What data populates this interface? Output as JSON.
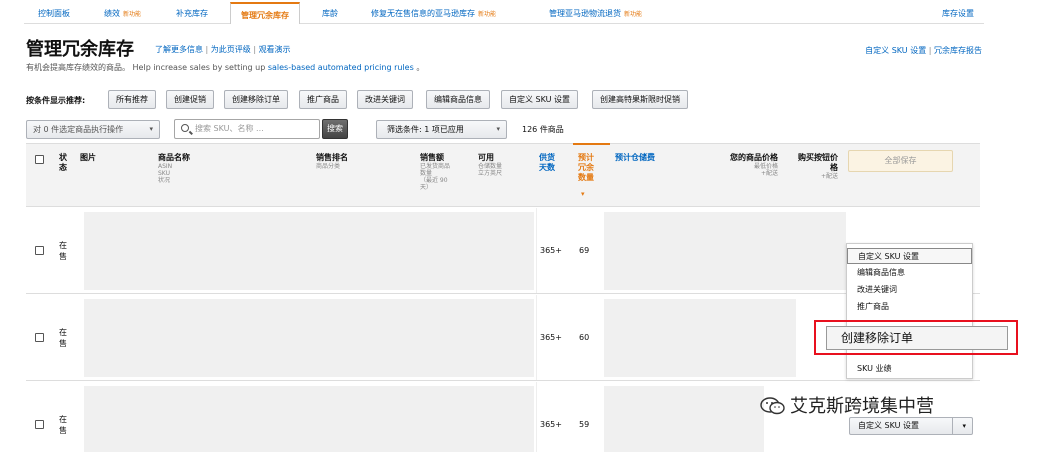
{
  "nav": {
    "tabs": [
      {
        "label": "控制面板",
        "badge": ""
      },
      {
        "label": "绩效",
        "badge": "新功能"
      },
      {
        "label": "补充库存",
        "badge": ""
      },
      {
        "label": "管理冗余库存",
        "badge": ""
      },
      {
        "label": "库龄",
        "badge": ""
      },
      {
        "label": "修复无在售信息的亚马逊库存",
        "badge": "新功能"
      },
      {
        "label": "管理亚马逊物流退货",
        "badge": "新功能"
      }
    ],
    "settings": "库存设置"
  },
  "header": {
    "title": "管理冗余库存",
    "links": [
      "了解更多信息",
      "为此页评级",
      "观看演示"
    ],
    "subtitle_prefix": "有机会提高库存绩效的商品。 Help increase sales by setting up",
    "subtitle_link": "sales-based automated pricing rules",
    "subtitle_suffix": "。",
    "right_links": [
      "自定义 SKU 设置",
      "冗余库存报告"
    ]
  },
  "filters": {
    "label": "按条件显示推荐:",
    "buttons": [
      "所有推荐",
      "创建促销",
      "创建移除订单",
      "推广商品",
      "改进关键词",
      "编辑商品信息",
      "自定义 SKU 设置",
      "创建高特果斯限时促销"
    ]
  },
  "toolbar": {
    "bulk_action": "对 0 件选定商品执行操作",
    "search_placeholder": "搜索 SKU、名称 ...",
    "search_button": "搜索",
    "filter_condition": "筛选条件: 1 项已应用",
    "item_count": "126 件商品"
  },
  "table": {
    "columns": {
      "status": "状态",
      "image": "图片",
      "product_name": "商品名称",
      "product_name_sub": [
        "ASIN",
        "SKU",
        "状况"
      ],
      "sales_rank": "销售排名",
      "sales_rank_sub": "商品分类",
      "sales": "销售额",
      "sales_sub": [
        "已发货商品",
        "数量",
        "（最近 90",
        "天）"
      ],
      "available": "可用",
      "available_sub": [
        "仓储数量",
        "立方英尺"
      ],
      "supply_days": "供货天数",
      "excess_units": [
        "预计",
        "冗余",
        "数量"
      ],
      "estimated_storage": "预计仓储费",
      "your_price": "您的商品价格",
      "your_price_sub": [
        "最低价格",
        "+配送"
      ],
      "buybox": "购买按钮价格",
      "buybox_sub": "+配送",
      "save_all": "全部保存"
    },
    "rows": [
      {
        "status": "在售",
        "supply_days": "365+",
        "excess": "69"
      },
      {
        "status": "在售",
        "supply_days": "365+",
        "excess": "60"
      },
      {
        "status": "在售",
        "supply_days": "365+",
        "excess": "59"
      }
    ]
  },
  "menu": {
    "items": [
      "自定义 SKU 设置",
      "编辑商品信息",
      "改进关键词",
      "推广商品",
      "创建移除订单",
      "SKU 业绩"
    ],
    "bottom_select": "自定义 SKU 设置"
  },
  "watermark": "艾克斯跨境集中营",
  "colors": {
    "link": "#0066c0",
    "accent": "#e47911",
    "highlight": "#e8101e"
  }
}
